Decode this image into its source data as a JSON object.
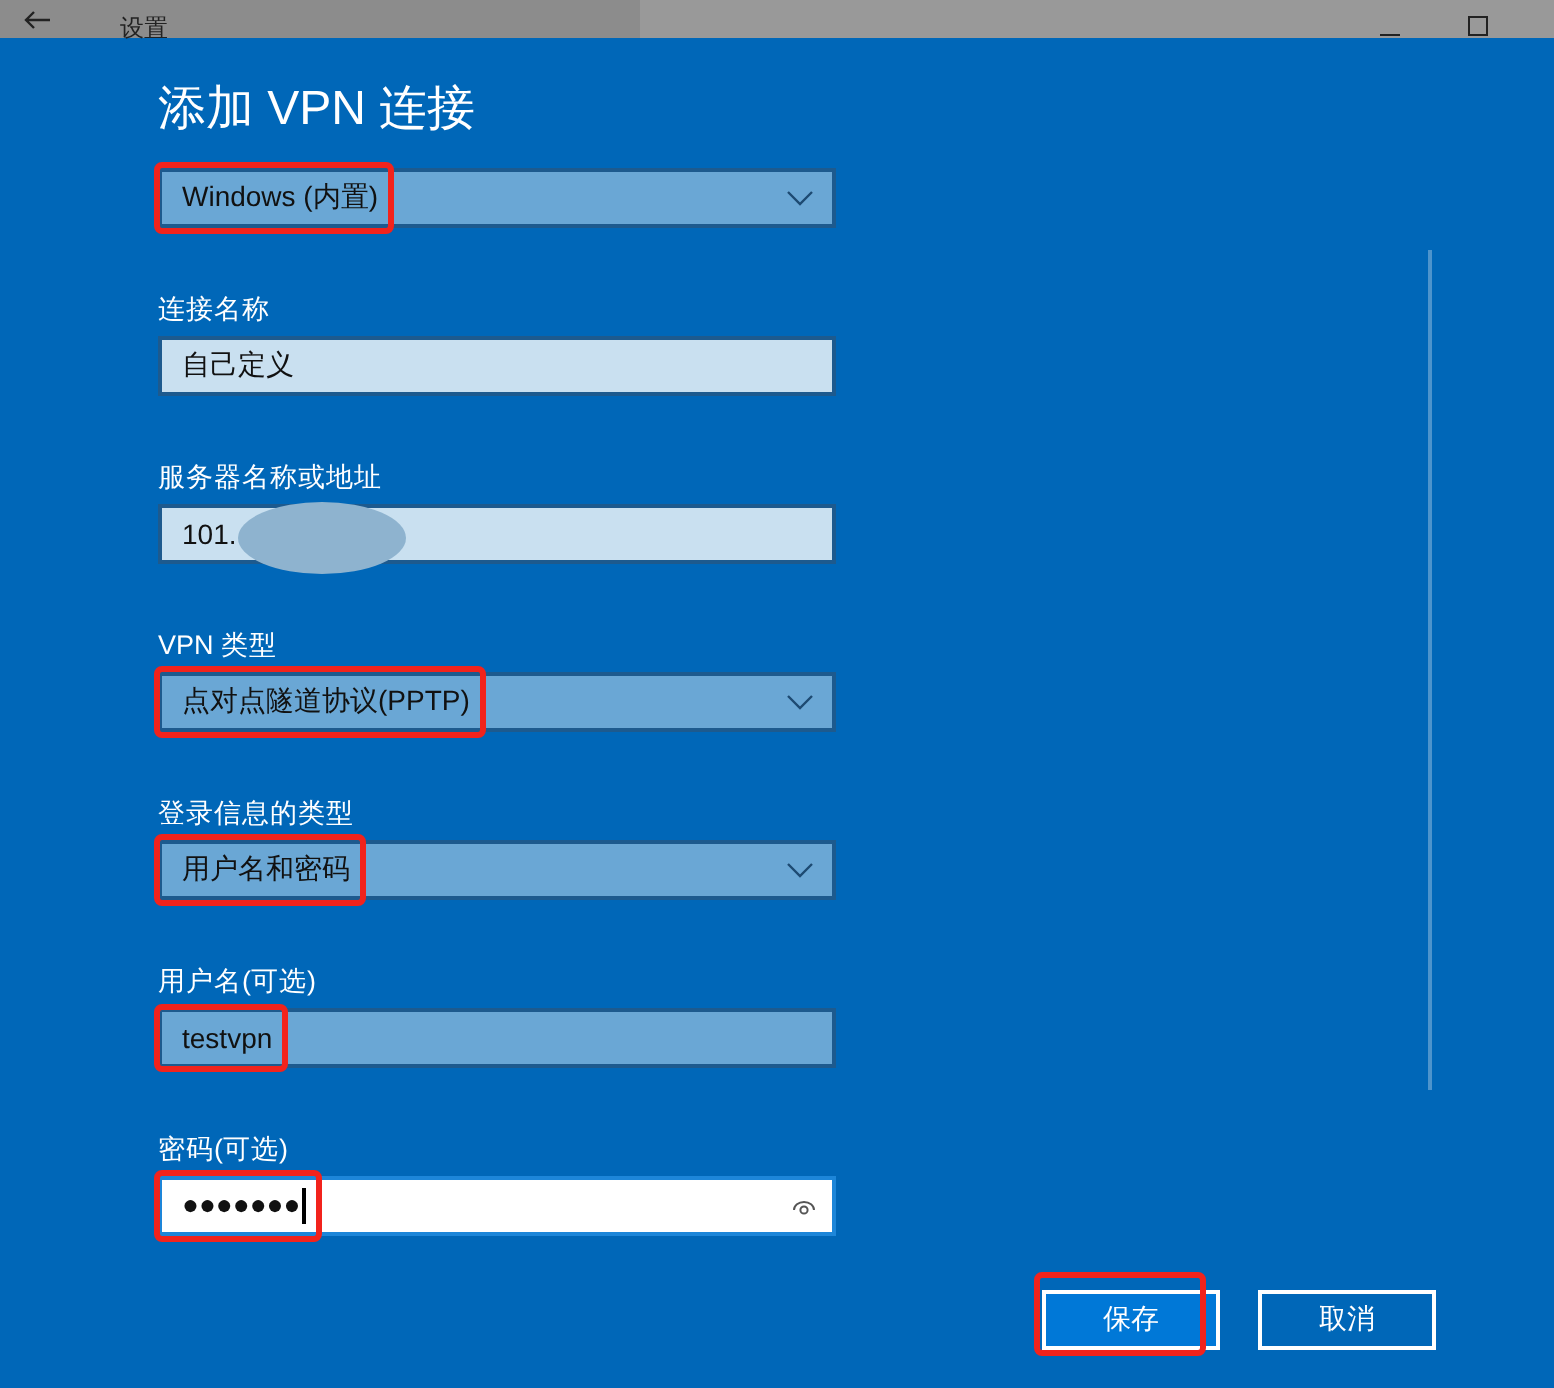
{
  "window": {
    "title": "设置"
  },
  "heading": "添加 VPN 连接",
  "fields": [
    {
      "kind": "dropdown",
      "value": "Windows (内置)",
      "highlighted": true
    },
    {
      "kind": "text",
      "label": "连接名称",
      "value": "自己定义",
      "highlighted": false,
      "hovered": false
    },
    {
      "kind": "text",
      "label": "服务器名称或地址",
      "value": "101.",
      "redacted": true,
      "highlighted": false,
      "hovered": false
    },
    {
      "kind": "dropdown",
      "label": "VPN 类型",
      "value": "点对点隧道协议(PPTP)",
      "highlighted": true
    },
    {
      "kind": "dropdown",
      "label": "登录信息的类型",
      "value": "用户名和密码",
      "highlighted": true
    },
    {
      "kind": "text",
      "label": "用户名(可选)",
      "value": "testvpn",
      "highlighted": true,
      "hovered": true
    },
    {
      "kind": "password",
      "label": "密码(可选)",
      "value": "●●●●●●●",
      "highlighted": true,
      "focused": true
    }
  ],
  "buttons": [
    {
      "label": "保存",
      "primary": true,
      "highlighted": true
    },
    {
      "label": "取消",
      "primary": false,
      "highlighted": false
    }
  ]
}
